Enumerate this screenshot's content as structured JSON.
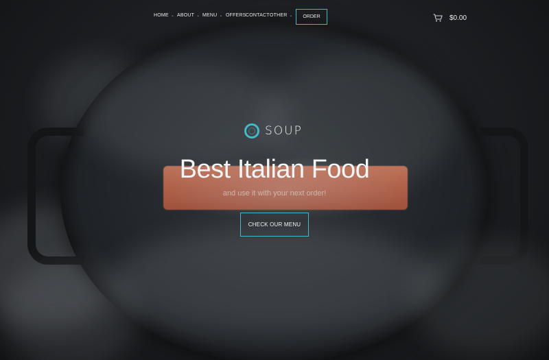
{
  "nav": {
    "items": [
      {
        "label": "HOME",
        "has_dropdown": true
      },
      {
        "label": "ABOUT",
        "has_dropdown": true
      },
      {
        "label": "MENU",
        "has_dropdown": true
      },
      {
        "label": "OFFERS",
        "has_dropdown": false
      },
      {
        "label": "CONTACT",
        "has_dropdown": false
      },
      {
        "label": "OTHER",
        "has_dropdown": true
      }
    ],
    "order_label": "ORDER"
  },
  "cart": {
    "icon": "cart-icon",
    "total": "$0.00"
  },
  "hero": {
    "logo_text": "SOUP",
    "headline": "Best Italian Food",
    "subline": "and use it with your next order!",
    "cta_label": "CHECK OUR MENU"
  },
  "colors": {
    "accent": "#42b8c8",
    "background": "#1b1d20",
    "text": "#f4f4f4"
  }
}
